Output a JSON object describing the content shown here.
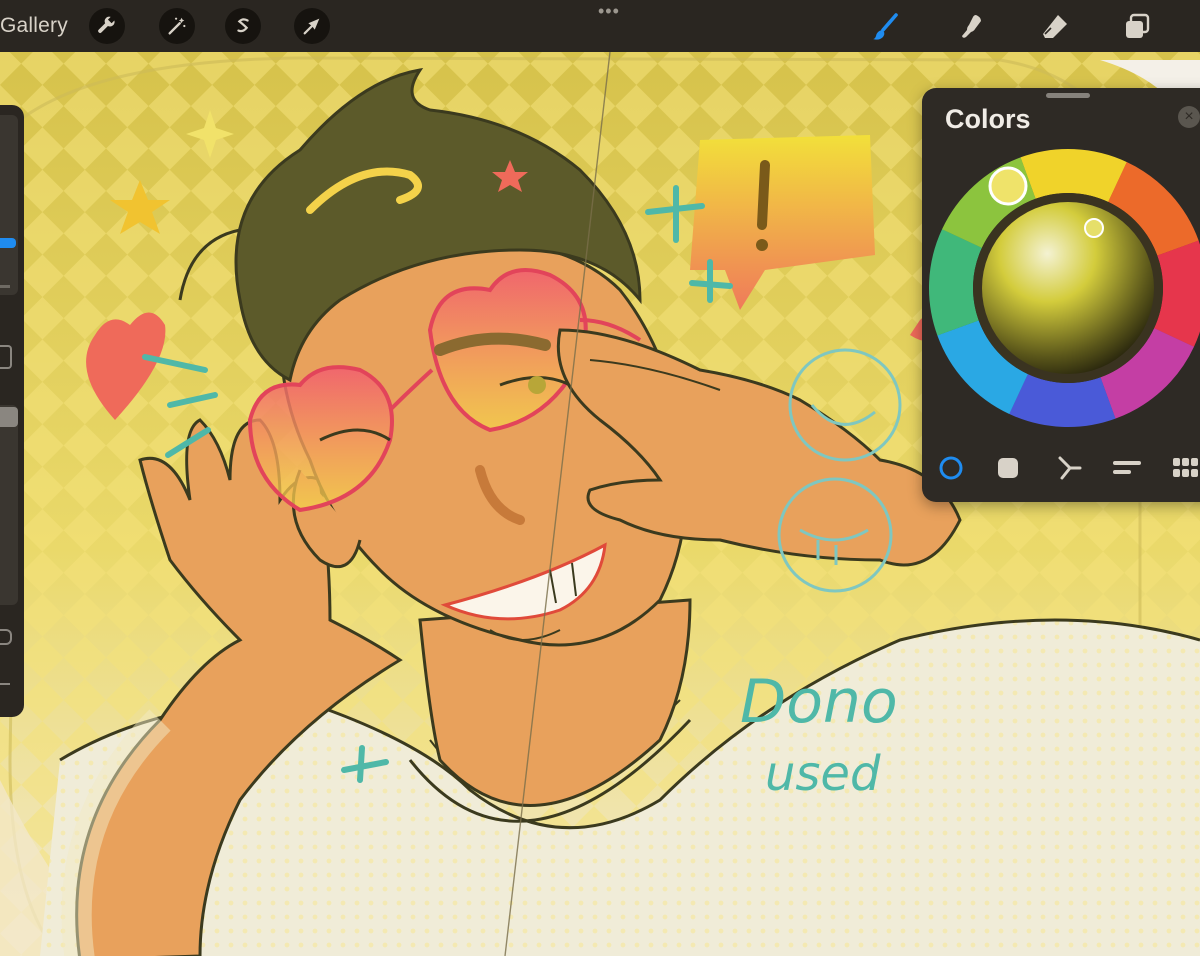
{
  "topbar": {
    "gallery_label": "Gallery",
    "left_tools": [
      {
        "name": "actions",
        "icon": "wrench-icon"
      },
      {
        "name": "adjustments",
        "icon": "magic-wand-icon"
      },
      {
        "name": "selection",
        "icon": "selection-s-icon"
      },
      {
        "name": "transform",
        "icon": "arrow-cursor-icon"
      }
    ],
    "more_icon": "dots-icon",
    "right_tools": [
      {
        "name": "brush",
        "icon": "brush-icon",
        "active": true
      },
      {
        "name": "smudge",
        "icon": "smudge-icon"
      },
      {
        "name": "eraser",
        "icon": "eraser-icon"
      },
      {
        "name": "layers",
        "icon": "layers-icon"
      }
    ]
  },
  "colors_panel": {
    "title": "Colors",
    "close_icon": "close-icon",
    "tabs": [
      {
        "name": "disc",
        "icon": "circle-icon",
        "active": true
      },
      {
        "name": "classic",
        "icon": "square-icon"
      },
      {
        "name": "harmony",
        "icon": "harmony-icon"
      },
      {
        "name": "value",
        "icon": "sliders-icon"
      },
      {
        "name": "palettes",
        "icon": "grid-icon"
      }
    ]
  },
  "canvas": {
    "annotation_text": "Dono\nused",
    "accent_colors": {
      "skin": "#e8a15c",
      "hair": "#5c5a2a",
      "glasses": "#e2445a",
      "teal": "#4fb8a8",
      "yellow": "#f1d938"
    }
  }
}
